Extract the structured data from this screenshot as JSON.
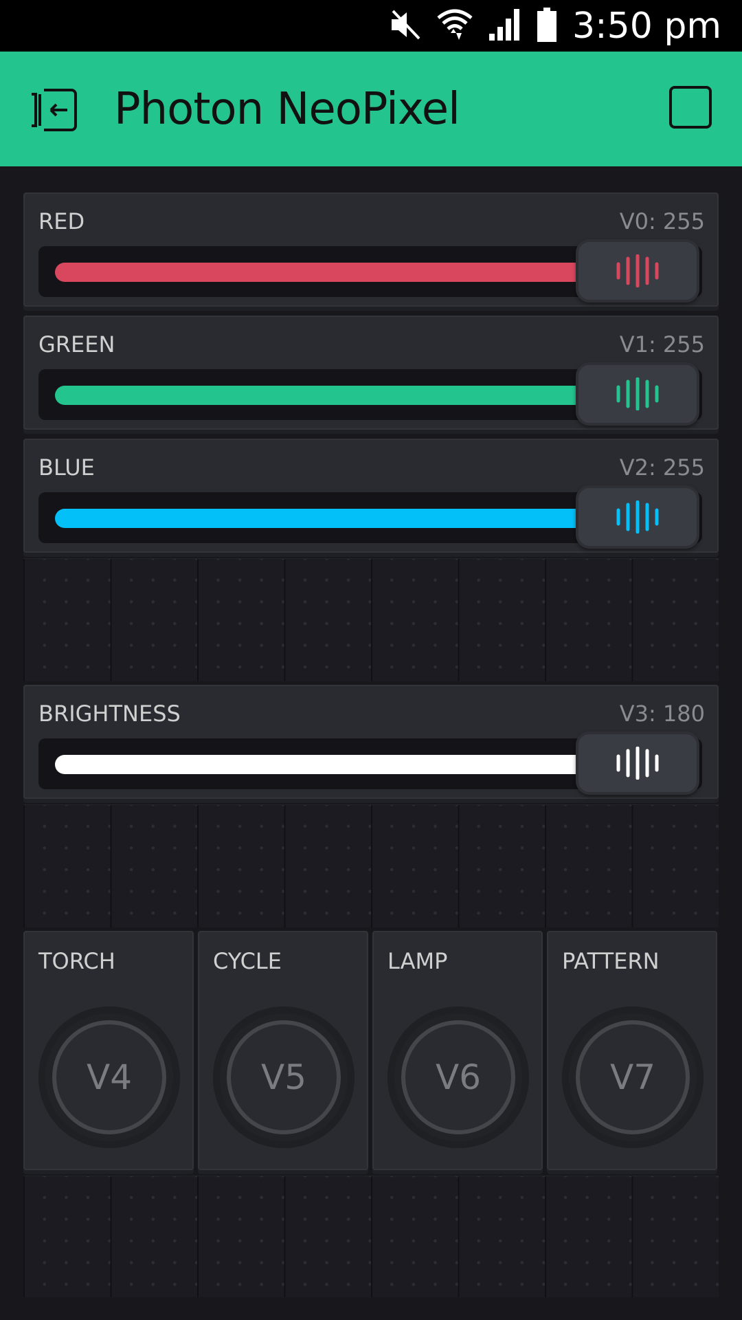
{
  "status_bar": {
    "time": "3:50 pm",
    "icons": [
      "mute-icon",
      "wifi-icon",
      "signal-icon",
      "battery-icon"
    ]
  },
  "app_bar": {
    "title": "Photon NeoPixel",
    "background": "#23c48e"
  },
  "sliders": [
    {
      "label": "RED",
      "pin": "V0: 255",
      "value": 255,
      "max": 255,
      "color": "#d9475f"
    },
    {
      "label": "GREEN",
      "pin": "V1: 255",
      "value": 255,
      "max": 255,
      "color": "#23c48e"
    },
    {
      "label": "BLUE",
      "pin": "V2: 255",
      "value": 255,
      "max": 255,
      "color": "#04c0f8"
    },
    {
      "label": "BRIGHTNESS",
      "pin": "V3: 180",
      "value": 180,
      "max": 255,
      "color": "#ffffff"
    }
  ],
  "buttons": [
    {
      "label": "TORCH",
      "pin": "V4"
    },
    {
      "label": "CYCLE",
      "pin": "V5"
    },
    {
      "label": "LAMP",
      "pin": "V6"
    },
    {
      "label": "PATTERN",
      "pin": "V7"
    }
  ]
}
